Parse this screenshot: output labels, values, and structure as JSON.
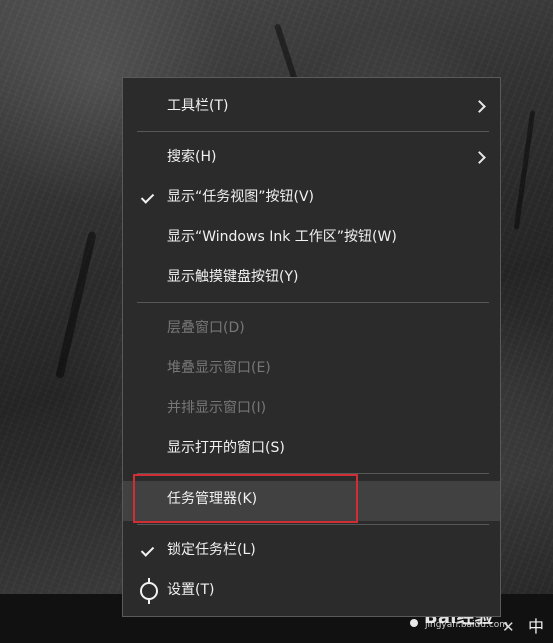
{
  "desktop": {
    "watermark": {
      "brand": "Bai经验",
      "url": "jingyan.baidu.com"
    }
  },
  "taskbar": {
    "tray": {
      "language": "中"
    }
  },
  "context_menu": {
    "items": [
      {
        "label": "工具栏(T)",
        "enabled": true
      },
      {
        "label": "搜索(H)",
        "enabled": true
      },
      {
        "label": "显示“任务视图”按钮(V)",
        "enabled": true,
        "checked": true
      },
      {
        "label": "显示“Windows Ink 工作区”按钮(W)",
        "enabled": true
      },
      {
        "label": "显示触摸键盘按钮(Y)",
        "enabled": true
      },
      {
        "label": "层叠窗口(D)",
        "enabled": false
      },
      {
        "label": "堆叠显示窗口(E)",
        "enabled": false
      },
      {
        "label": "并排显示窗口(I)",
        "enabled": false
      },
      {
        "label": "显示打开的窗口(S)",
        "enabled": true
      },
      {
        "label": "任务管理器(K)",
        "enabled": true,
        "highlighted": true
      },
      {
        "label": "锁定任务栏(L)",
        "enabled": true,
        "checked": true
      },
      {
        "label": "设置(T)",
        "enabled": true
      }
    ]
  },
  "colors": {
    "menu_background": "#2b2b2b",
    "menu_border": "#5a5a5a",
    "menu_text": "#f1f1f1",
    "menu_text_disabled": "#777777",
    "menu_highlight": "#414141",
    "annotation_red": "#d12d35",
    "taskbar": "#111111"
  },
  "icons": {
    "submenu": "chevron-right-icon",
    "checked": "check-icon",
    "settings": "gear-icon"
  }
}
